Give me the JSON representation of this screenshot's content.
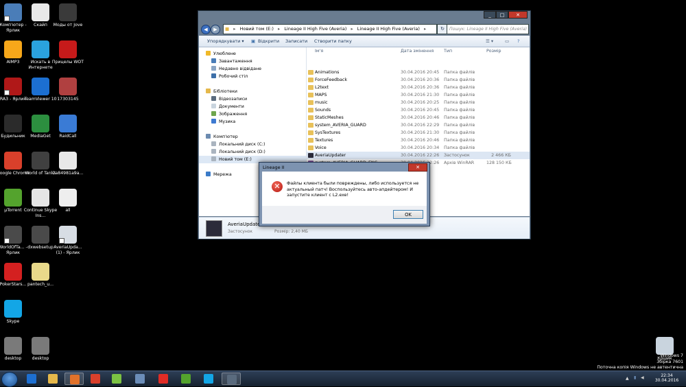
{
  "desktop_icons": [
    {
      "label": "Комп'ютер - Ярлик",
      "color": "#4a7db8"
    },
    {
      "label": "Скайп",
      "color": "#e9e9e9"
    },
    {
      "label": "Моды от Jove",
      "color": "#3a3a3a"
    },
    {
      "label": "AIMP3",
      "color": "#f7a71a"
    },
    {
      "label": "Искать в Интернете",
      "color": "#2aa2de"
    },
    {
      "label": "Прицелы WOT",
      "color": "#c61a1a"
    },
    {
      "label": "RA3 - Ярлик",
      "color": "#b01818"
    },
    {
      "label": "TeamViewer 10",
      "color": "#1c6fd1"
    },
    {
      "label": "17303145",
      "color": "#b04040"
    },
    {
      "label": "Будильник",
      "color": "#2b2b2b"
    },
    {
      "label": "MediaGet",
      "color": "#2c8f3f"
    },
    {
      "label": "RaidCall",
      "color": "#3a7bd5"
    },
    {
      "label": "Google Chrome",
      "color": "#d9402b"
    },
    {
      "label": "World of Tanks",
      "color": "#404040"
    },
    {
      "label": "2a84981a9a...",
      "color": "#e8e8e8"
    },
    {
      "label": "µTorrent",
      "color": "#54a32d"
    },
    {
      "label": "Continue Skype Ins...",
      "color": "#e6e6e6"
    },
    {
      "label": "all",
      "color": "#eeeeee"
    },
    {
      "label": "WorldOfTa... - Ярлик",
      "color": "#4a4a4a"
    },
    {
      "label": "dxwebsetup",
      "color": "#4a4a4a"
    },
    {
      "label": "AveriaUpda... (1) - Ярлик",
      "color": "#d7dde4"
    },
    {
      "label": "PokerStars...",
      "color": "#d42020"
    },
    {
      "label": "pantech_u...",
      "color": "#e9d98a"
    },
    {
      "label": "Skype",
      "color": "#13a6e6"
    },
    {
      "label": "desktop",
      "color": "#7a7a7a"
    },
    {
      "label": "desktop",
      "color": "#7a7a7a"
    },
    {
      "label": "Кошик",
      "color": "#c9d4de"
    }
  ],
  "explorer": {
    "address": [
      "Новий том (E:)",
      "Lineage II High Five (Averia)",
      "Lineage II High Five (Averia)"
    ],
    "search_placeholder": "Пошук: Lineage II High Five (Averia)",
    "toolbar": {
      "organize": "Упорядкувати ▾",
      "open": "Відкрити",
      "burn": "Записати",
      "new_folder": "Створити папку"
    },
    "nav": [
      {
        "label": "Улюблене",
        "icon_color": "#f0b929"
      },
      {
        "label": "Завантаження",
        "icon_color": "#4a7db8"
      },
      {
        "label": "Недавно відвідане",
        "icon_color": "#8ba5c4"
      },
      {
        "label": "Робочий стіл",
        "icon_color": "#3d6fa8"
      },
      {
        "label": "Бібліотеки",
        "icon_color": "#e5b84b"
      },
      {
        "label": "Відеозаписи",
        "icon_color": "#5a6b7e"
      },
      {
        "label": "Документи",
        "icon_color": "#c9d4de"
      },
      {
        "label": "Зображення",
        "icon_color": "#6ea54c"
      },
      {
        "label": "Музика",
        "icon_color": "#3e7ad1"
      },
      {
        "label": "Комп'ютер",
        "icon_color": "#6c8bb0"
      },
      {
        "label": "Локальний диск (C:)",
        "icon_color": "#aab4bf"
      },
      {
        "label": "Локальний диск (D:)",
        "icon_color": "#aab4bf"
      },
      {
        "label": "Новий том (E:)",
        "icon_color": "#aab4bf"
      },
      {
        "label": "Мережа",
        "icon_color": "#3b7bc8"
      }
    ],
    "columns": {
      "name": "Ім'я",
      "date": "Дата змінення",
      "type": "Тип",
      "size": "Розмір"
    },
    "files": [
      {
        "name": "Animations",
        "date": "30.04.2016 20:45",
        "type": "Папка файлів",
        "size": "",
        "color": "#e8c15a"
      },
      {
        "name": "ForceFeedback",
        "date": "30.04.2016 20:36",
        "type": "Папка файлів",
        "size": "",
        "color": "#e8c15a"
      },
      {
        "name": "L2text",
        "date": "30.04.2016 20:36",
        "type": "Папка файлів",
        "size": "",
        "color": "#e8c15a"
      },
      {
        "name": "MAPS",
        "date": "30.04.2016 21:30",
        "type": "Папка файлів",
        "size": "",
        "color": "#e8c15a"
      },
      {
        "name": "music",
        "date": "30.04.2016 20:25",
        "type": "Папка файлів",
        "size": "",
        "color": "#e8c15a"
      },
      {
        "name": "Sounds",
        "date": "30.04.2016 20:45",
        "type": "Папка файлів",
        "size": "",
        "color": "#e8c15a"
      },
      {
        "name": "StaticMeshes",
        "date": "30.04.2016 20:46",
        "type": "Папка файлів",
        "size": "",
        "color": "#e8c15a"
      },
      {
        "name": "system_AVERIA_GUARD",
        "date": "30.04.2016 22:29",
        "type": "Папка файлів",
        "size": "",
        "color": "#e8c15a"
      },
      {
        "name": "SysTextures",
        "date": "30.04.2016 21:30",
        "type": "Папка файлів",
        "size": "",
        "color": "#e8c15a"
      },
      {
        "name": "Textures",
        "date": "30.04.2016 20:46",
        "type": "Папка файлів",
        "size": "",
        "color": "#e8c15a"
      },
      {
        "name": "Voice",
        "date": "30.04.2016 20:34",
        "type": "Папка файлів",
        "size": "",
        "color": "#e8c15a"
      },
      {
        "name": "AveriaUpdater",
        "date": "30.04.2016 22:26",
        "type": "Застосунок",
        "size": "2 466 КБ",
        "color": "#2b2b3a"
      },
      {
        "name": "system_AVERIA_GUARD_ENG",
        "date": "30.04.2016 22:26",
        "type": "Архів WinRAR",
        "size": "128 150 КБ",
        "color": "#8a5ca8"
      }
    ],
    "details": {
      "name": "AveriaUpdater",
      "type": "Застосунок",
      "size_label": "Розмір: 2,40 МБ"
    }
  },
  "dialog": {
    "title": "Lineage II",
    "message": "Файлы клиента были повреждены, либо используется не актуальный патч! Воспользуйтесь авто-апдейтером! И запустите клиент с L2.exe!",
    "ok": "OK"
  },
  "watermark": {
    "line1": "Windows 7",
    "line2": "Збірка 7601",
    "line3": "Поточна копія Windows не автентична"
  },
  "clock": {
    "time": "22:34",
    "date": "30.04.2016"
  },
  "taskbar_apps": [
    {
      "name": "Internet Explorer",
      "color": "#1d6fd1"
    },
    {
      "name": "Провідник",
      "color": "#e5b84b"
    },
    {
      "name": "Media Player",
      "color": "#e1722a"
    },
    {
      "name": "Google Chrome",
      "color": "#d9402b"
    },
    {
      "name": "ICQ",
      "color": "#7cc243"
    },
    {
      "name": "Volume",
      "color": "#6b8db8"
    },
    {
      "name": "Yandex",
      "color": "#e02c25"
    },
    {
      "name": "µTorrent",
      "color": "#54a32d"
    },
    {
      "name": "Skype",
      "color": "#13a6e6"
    },
    {
      "name": "Lineage II",
      "color": "#5a6b7e"
    }
  ]
}
